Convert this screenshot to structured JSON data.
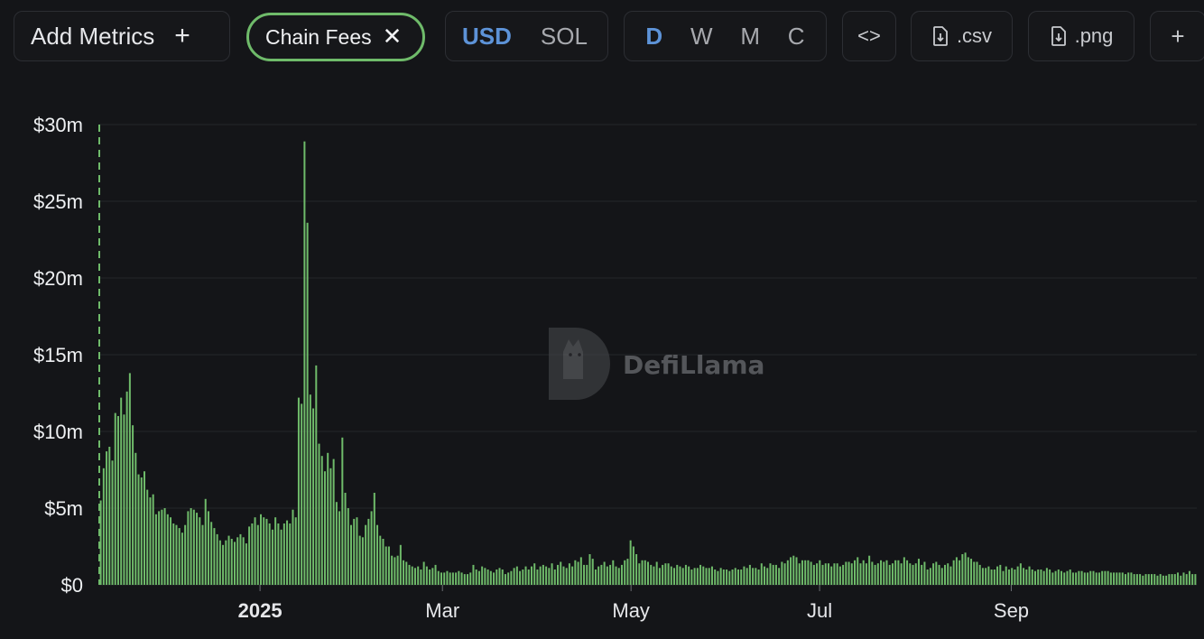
{
  "toolbar": {
    "add_metrics_label": "Add Metrics",
    "add_icon": "plus-icon",
    "chip_label": "Chain Fees",
    "chip_close_icon": "close-icon",
    "currency_options": [
      "USD",
      "SOL"
    ],
    "currency_selected": "USD",
    "period_options": [
      "D",
      "W",
      "M",
      "C"
    ],
    "period_selected": "D",
    "embed_icon": "code-brackets-icon",
    "csv_label": ".csv",
    "png_label": ".png",
    "download_icon": "file-download-icon",
    "more_label": "+"
  },
  "watermark": {
    "text": "DefiLlama",
    "icon": "llama-logo-icon"
  },
  "colors": {
    "bar": "#6fbb6a",
    "accent": "#5d93d8",
    "chip_border": "#6fbb6a",
    "background": "#141518"
  },
  "chart_data": {
    "type": "bar",
    "series": [
      {
        "name": "Chain Fees"
      }
    ],
    "y_unit": "$",
    "ylim": [
      0,
      30000000
    ],
    "y_ticks": [
      "$0",
      "$5m",
      "$10m",
      "$15m",
      "$20m",
      "$25m",
      "$30m"
    ],
    "x_range": [
      "2024-11-10",
      "2025-10-31"
    ],
    "x_ticks": [
      {
        "label": "2025",
        "date": "2025-01-01",
        "bold": true
      },
      {
        "label": "Mar",
        "date": "2025-03-01",
        "bold": false
      },
      {
        "label": "May",
        "date": "2025-05-01",
        "bold": false
      },
      {
        "label": "Jul",
        "date": "2025-07-01",
        "bold": false
      },
      {
        "label": "Sep",
        "date": "2025-09-01",
        "bold": false
      }
    ],
    "grid": "horizontal",
    "values_millions": [
      5.5,
      7.6,
      8.7,
      9.0,
      8.1,
      11.2,
      11.0,
      12.2,
      11.1,
      12.6,
      13.8,
      10.4,
      8.6,
      7.2,
      7.0,
      7.4,
      6.2,
      5.7,
      5.9,
      4.6,
      4.8,
      4.9,
      5.0,
      4.6,
      4.4,
      4.0,
      3.9,
      3.7,
      3.4,
      3.9,
      4.8,
      5.0,
      4.9,
      4.7,
      4.4,
      3.9,
      5.6,
      4.8,
      4.1,
      3.7,
      3.3,
      2.9,
      2.6,
      2.9,
      3.2,
      3.0,
      2.8,
      3.1,
      3.3,
      3.1,
      2.7,
      3.8,
      4.0,
      4.4,
      3.9,
      4.6,
      4.4,
      4.3,
      4.0,
      3.6,
      4.4,
      4.0,
      3.6,
      4.0,
      4.2,
      4.0,
      4.9,
      4.4,
      12.2,
      11.8,
      28.9,
      23.6,
      12.4,
      11.5,
      14.3,
      9.2,
      8.4,
      7.4,
      8.6,
      7.6,
      8.2,
      5.4,
      4.8,
      9.6,
      6.0,
      5.0,
      3.9,
      4.3,
      4.4,
      3.2,
      3.1,
      3.9,
      4.3,
      4.8,
      6.0,
      3.9,
      3.2,
      3.0,
      2.5,
      2.5,
      1.9,
      1.8,
      1.9,
      2.6,
      1.6,
      1.5,
      1.3,
      1.2,
      1.1,
      1.2,
      1.0,
      1.5,
      1.2,
      1.0,
      1.1,
      1.3,
      0.9,
      0.8,
      0.8,
      0.9,
      0.8,
      0.8,
      0.8,
      0.9,
      0.8,
      0.7,
      0.7,
      0.8,
      1.3,
      1.0,
      0.9,
      1.2,
      1.1,
      1.0,
      0.9,
      0.8,
      1.0,
      1.1,
      1.0,
      0.7,
      0.8,
      0.9,
      1.1,
      1.2,
      0.9,
      1.0,
      1.2,
      1.0,
      1.2,
      1.4,
      1.0,
      1.2,
      1.3,
      1.2,
      1.1,
      1.4,
      1.0,
      1.3,
      1.5,
      1.2,
      1.1,
      1.4,
      1.2,
      1.6,
      1.5,
      1.8,
      1.3,
      1.3,
      2.0,
      1.7,
      1.0,
      1.2,
      1.3,
      1.5,
      1.2,
      1.3,
      1.6,
      1.2,
      1.1,
      1.3,
      1.6,
      1.7,
      2.9,
      2.5,
      2.0,
      1.4,
      1.6,
      1.6,
      1.5,
      1.3,
      1.2,
      1.5,
      1.1,
      1.3,
      1.4,
      1.4,
      1.2,
      1.1,
      1.3,
      1.2,
      1.1,
      1.3,
      1.2,
      1.0,
      1.1,
      1.1,
      1.3,
      1.2,
      1.1,
      1.1,
      1.2,
      1.0,
      0.9,
      1.1,
      1.0,
      1.0,
      0.9,
      1.0,
      1.1,
      1.0,
      1.0,
      1.2,
      1.1,
      1.3,
      1.1,
      1.1,
      1.0,
      1.4,
      1.2,
      1.1,
      1.4,
      1.3,
      1.3,
      1.1,
      1.5,
      1.4,
      1.6,
      1.8,
      1.9,
      1.8,
      1.4,
      1.6,
      1.6,
      1.6,
      1.5,
      1.3,
      1.4,
      1.6,
      1.3,
      1.4,
      1.4,
      1.2,
      1.4,
      1.4,
      1.2,
      1.3,
      1.5,
      1.5,
      1.4,
      1.6,
      1.8,
      1.4,
      1.6,
      1.4,
      1.9,
      1.5,
      1.3,
      1.4,
      1.6,
      1.5,
      1.6,
      1.3,
      1.4,
      1.6,
      1.6,
      1.4,
      1.8,
      1.6,
      1.4,
      1.3,
      1.4,
      1.7,
      1.3,
      1.5,
      1.0,
      1.1,
      1.4,
      1.5,
      1.3,
      1.1,
      1.3,
      1.4,
      1.2,
      1.6,
      1.8,
      1.6,
      2.0,
      2.1,
      1.8,
      1.7,
      1.5,
      1.5,
      1.3,
      1.1,
      1.1,
      1.2,
      1.0,
      1.0,
      1.2,
      1.3,
      0.9,
      1.2,
      1.0,
      1.1,
      1.0,
      1.2,
      1.4,
      1.1,
      1.0,
      1.2,
      1.0,
      0.9,
      1.0,
      1.0,
      0.9,
      1.1,
      1.0,
      0.8,
      0.9,
      1.0,
      0.9,
      0.8,
      0.9,
      1.0,
      0.8,
      0.8,
      0.9,
      0.9,
      0.8,
      0.8,
      0.9,
      0.9,
      0.8,
      0.8,
      0.9,
      0.9,
      0.9,
      0.8,
      0.8,
      0.8,
      0.8,
      0.8,
      0.7,
      0.8,
      0.8,
      0.7,
      0.7,
      0.7,
      0.6,
      0.7,
      0.7,
      0.7,
      0.7,
      0.6,
      0.7,
      0.6,
      0.6,
      0.7,
      0.7,
      0.7,
      0.8,
      0.6,
      0.8,
      0.7,
      0.9,
      0.7,
      0.7
    ]
  }
}
